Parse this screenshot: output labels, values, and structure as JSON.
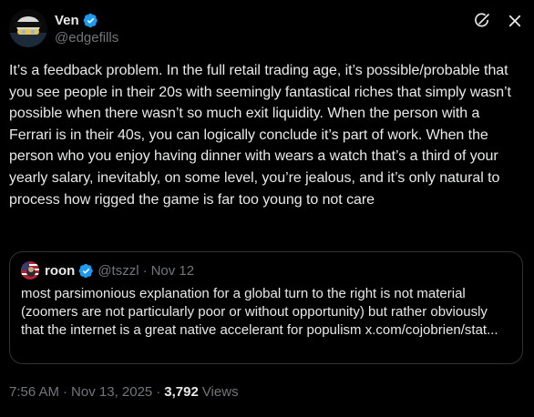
{
  "author": {
    "display_name": "Ven",
    "handle": "@edgefills",
    "avatar_icon": "avatar-image",
    "verified": true
  },
  "post": {
    "text": "It’s a feedback problem. In the full retail trading age, it’s possible/probable that you see people in their 20s with seemingly fantastical riches that simply wasn’t possible when there wasn’t so much exit liquidity. When the person with a Ferrari is in their 40s, you can logically conclude it’s part of work. When the person who you enjoy having dinner with wears a watch that’s a third of your yearly salary, inevitably, on some level, you’re jealous, and it’s only natural to process how rigged the game is far too young to not care"
  },
  "quoted_post": {
    "display_name": "roon",
    "handle": "@tszzl",
    "separator": "·",
    "date": "Nov 12",
    "verified": true,
    "text": "most parsimonious explanation for a global turn to the right is not material (zoomers are not particularly poor or without opportunity) but rather obviously that the internet is a great native accelerant for populism x.com/cojobrien/stat..."
  },
  "meta": {
    "time": "7:56 AM",
    "separator": "·",
    "date": "Nov 13, 2025",
    "separator2": "·",
    "views_count": "3,792",
    "views_label": "Views"
  },
  "icons": {
    "grok": "grok-icon",
    "close": "close-icon"
  },
  "colors": {
    "background": "#000000",
    "text": "#e7e9ea",
    "secondary": "#71767b",
    "border": "#2f3336",
    "verified": "#1d9bf0"
  }
}
